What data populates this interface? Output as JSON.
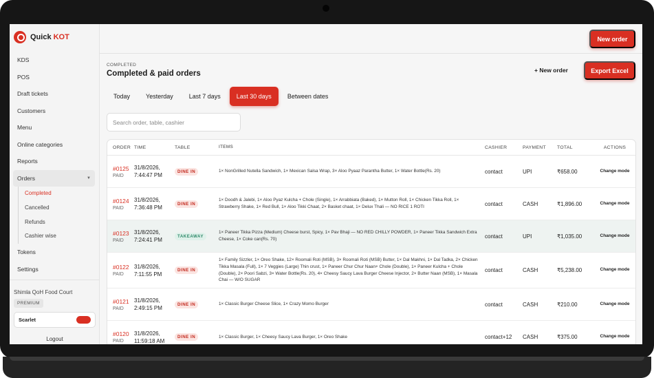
{
  "brand": {
    "name": "Quick",
    "accent": "KOT",
    "accent_color": "#d92f22"
  },
  "sidebar": {
    "items": [
      {
        "label": "KDS"
      },
      {
        "label": "POS"
      },
      {
        "label": "Draft tickets"
      },
      {
        "label": "Customers"
      },
      {
        "label": "Menu"
      },
      {
        "label": "Online categories"
      },
      {
        "label": "Reports"
      }
    ],
    "orders_group": {
      "label": "Orders",
      "subitems": [
        {
          "label": "Completed",
          "active": true
        },
        {
          "label": "Cancelled"
        },
        {
          "label": "Refunds"
        },
        {
          "label": "Cashier wise"
        }
      ]
    },
    "after_items": [
      {
        "label": "Tokens"
      },
      {
        "label": "Settings"
      }
    ],
    "venue": "Shimla QoH Food Court",
    "tier": "PREMIUM",
    "user": "Scarlet",
    "logout": "Logout"
  },
  "topbar": {
    "new_order": "New order"
  },
  "header": {
    "kicker": "COMPLETED",
    "title": "Completed & paid orders",
    "plus_new_order": "+ New order",
    "export": "Export Excel"
  },
  "filters": [
    {
      "label": "Today"
    },
    {
      "label": "Yesterday"
    },
    {
      "label": "Last 7 days"
    },
    {
      "label": "Last 30 days",
      "active": true
    },
    {
      "label": "Between dates"
    }
  ],
  "search": {
    "placeholder": "Search order, table, cashier",
    "value": ""
  },
  "table": {
    "columns": [
      "ORDER",
      "TIME",
      "TABLE",
      "ITEMS",
      "CASHIER",
      "PAYMENT",
      "TOTAL",
      "ACTIONS"
    ],
    "rows": [
      {
        "order": "#0125",
        "status": "PAID",
        "date": "31/8/2026,",
        "time": "7:44:47 PM",
        "table": "DINE IN",
        "table_kind": "dine",
        "items": "1× NonGrilled Nutella Sandwich, 1× Mexican Salsa Wrap, 3× Aloo Pyaaz Parantha Butter, 1× Water Bottle(Rs. 20)",
        "cashier": "contact",
        "payment": "UPI",
        "total": "₹658.00",
        "action": "Change mode"
      },
      {
        "order": "#0124",
        "status": "PAID",
        "date": "31/8/2026,",
        "time": "7:36:48 PM",
        "table": "DINE IN",
        "table_kind": "dine",
        "items": "1× Doodh & Jalebi, 1× Aloo Pyaz Kulcha + Chole (Single), 1× Arrabbiata (Baked), 1× Mutton Roll, 1× Chicken Tikka Roll, 1× Strawberry Shake, 1× Red Bull, 1× Aloo Tikki Chaat, 2× Basket chaat, 1× Delux Thali — NO RICE 1 ROTI",
        "cashier": "contact",
        "payment": "CASH",
        "total": "₹1,896.00",
        "action": "Change mode"
      },
      {
        "order": "#0123",
        "status": "PAID",
        "date": "31/8/2026,",
        "time": "7:24:41 PM",
        "table": "TAKEAWAY",
        "table_kind": "take",
        "items": "1× Paneer Tikka Pizza (Medium) Cheese burst, Spicy, 1× Pav Bhaji — NO RED CHILLY POWDER, 1× Paneer Tikka Sandwich Extra Cheese, 1× Coke can(Rs. 70)",
        "cashier": "contact",
        "payment": "UPI",
        "total": "₹1,035.00",
        "action": "Change mode",
        "highlight": true
      },
      {
        "order": "#0122",
        "status": "PAID",
        "date": "31/8/2026,",
        "time": "7:11:55 PM",
        "table": "DINE IN",
        "table_kind": "dine",
        "items": "1× Family Sizzler, 1× Oreo Shake, 12× Roomali Roti (MSB), 3× Roomali Roti (MSB) Butter, 1× Dal Makhni, 1× Dal Tadka, 2× Chicken Tikka Masala (Full), 1× 7 Veggies (Large) Thin crust, 1× Paneer Chur Chur Naan+ Chole (Double), 1× Paneer Kulcha + Chole (Double), 2× Poori Sabzi, 3× Water Bottle(Rs. 20), 4× Cheesy Saucy Lava Burger Cheese Injector, 2× Butter Naan (MSB), 1× Masala Chai — W/O SUGAR",
        "cashier": "contact",
        "payment": "CASH",
        "total": "₹5,238.00",
        "action": "Change mode"
      },
      {
        "order": "#0121",
        "status": "PAID",
        "date": "31/8/2026,",
        "time": "2:49:15 PM",
        "table": "DINE IN",
        "table_kind": "dine",
        "items": "1× Classic Burger Cheese Slice, 1× Crazy Momo Burger",
        "cashier": "contact",
        "payment": "CASH",
        "total": "₹210.00",
        "action": "Change mode"
      },
      {
        "order": "#0120",
        "status": "PAID",
        "date": "31/8/2026,",
        "time": "11:59:18 AM",
        "table": "DINE IN",
        "table_kind": "dine",
        "items": "1× Classic Burger, 1× Cheesy Saucy Lava Burger, 1× Oreo Shake",
        "cashier": "contact+12",
        "payment": "CASH",
        "total": "₹375.00",
        "action": "Change mode"
      }
    ]
  }
}
